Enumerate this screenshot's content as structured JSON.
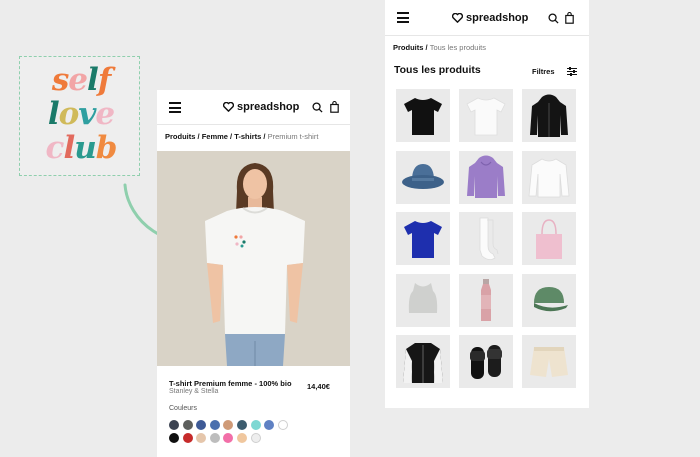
{
  "sticker": {
    "lines": [
      "self",
      "love",
      "club"
    ]
  },
  "product_page": {
    "brand_name": "spreadshop",
    "breadcrumb": {
      "l1": "Produits",
      "l2": "Femme",
      "l3": "T-shirts",
      "current": "Premium t-shirt",
      "sep": " / "
    },
    "product": {
      "title": "T-shirt Premium femme - 100% bio",
      "brand": "Stanley & Stella",
      "price": "14,40€"
    },
    "colors_label": "Couleurs",
    "swatch_colors": [
      "#3b4251",
      "#5d5f5d",
      "#3e5a96",
      "#4a6fae",
      "#cf9a77",
      "#3c5c6e",
      "#7dd8d3",
      "#5f81c3",
      "#ffffff",
      "#0f0f0f",
      "#c62a2a",
      "#e5c6ab",
      "#bdbdbd",
      "#f26fa8",
      "#f0c79e",
      "#eeeeee"
    ],
    "accent": "#8fcfad"
  },
  "listing_page": {
    "brand_name": "spreadshop",
    "breadcrumb": {
      "l1": "Produits",
      "current": "Tous les produits",
      "sep": " / "
    },
    "title": "Tous les produits",
    "filters_label": "Filtres",
    "products": [
      {
        "name": "black-tshirt"
      },
      {
        "name": "white-tshirt"
      },
      {
        "name": "black-zip-hoodie"
      },
      {
        "name": "denim-bucket-hat"
      },
      {
        "name": "lilac-hoodie"
      },
      {
        "name": "white-sweatshirt"
      },
      {
        "name": "royal-blue-tshirt"
      },
      {
        "name": "white-socks"
      },
      {
        "name": "pink-tote-bag"
      },
      {
        "name": "grey-crop-tank"
      },
      {
        "name": "pink-water-bottle"
      },
      {
        "name": "green-cap"
      },
      {
        "name": "varsity-jacket"
      },
      {
        "name": "black-slides"
      },
      {
        "name": "cream-shorts"
      }
    ]
  }
}
